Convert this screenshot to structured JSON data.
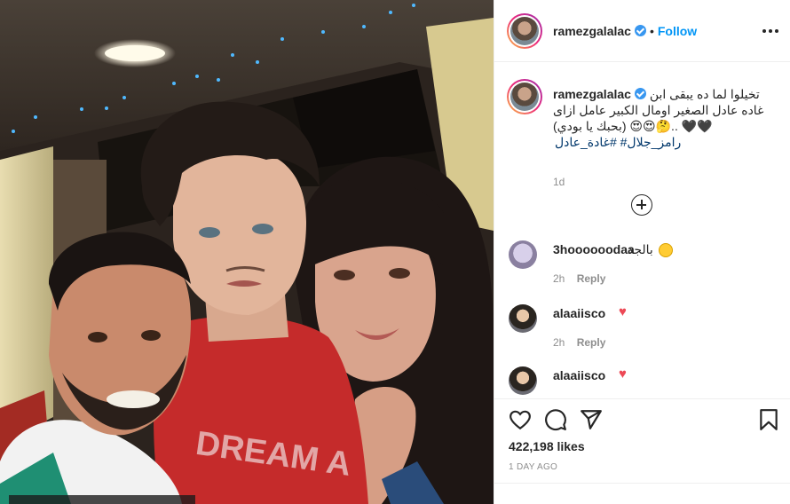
{
  "post": {
    "username": "ramezgalalac",
    "dot": "•",
    "follow_label": "Follow"
  },
  "caption": {
    "username": "ramezgalalac",
    "text": "تخيلوا لما ده يبقى ابن غاده عادل الصغير اومال الكبير عامل ازاى 🖤🖤 ..🤔😍😍 (بحبك يا بودي)",
    "hashtags": "رامز_جلال# #غادة_عادل",
    "time": "1d"
  },
  "comments": [
    {
      "username": "3hoooooodaa",
      "text": "بالجد",
      "emoji": "laugh",
      "time": "2h",
      "reply_label": "Reply"
    },
    {
      "username": "alaaiisco",
      "text": "",
      "emoji": "heart",
      "time": "2h",
      "reply_label": "Reply"
    },
    {
      "username": "alaaiisco",
      "text": "",
      "emoji": "heart"
    }
  ],
  "icons": {
    "heart": "♥",
    "like": "like-icon",
    "comment": "comment-icon",
    "share": "share-icon",
    "save": "save-icon"
  },
  "stats": {
    "likes": "422,198 likes",
    "timestamp": "1 DAY AGO"
  },
  "colors": {
    "accent": "#0095f6",
    "verified": "#3897f0",
    "heart": "#ed4956",
    "muted": "#8e8e8e"
  }
}
